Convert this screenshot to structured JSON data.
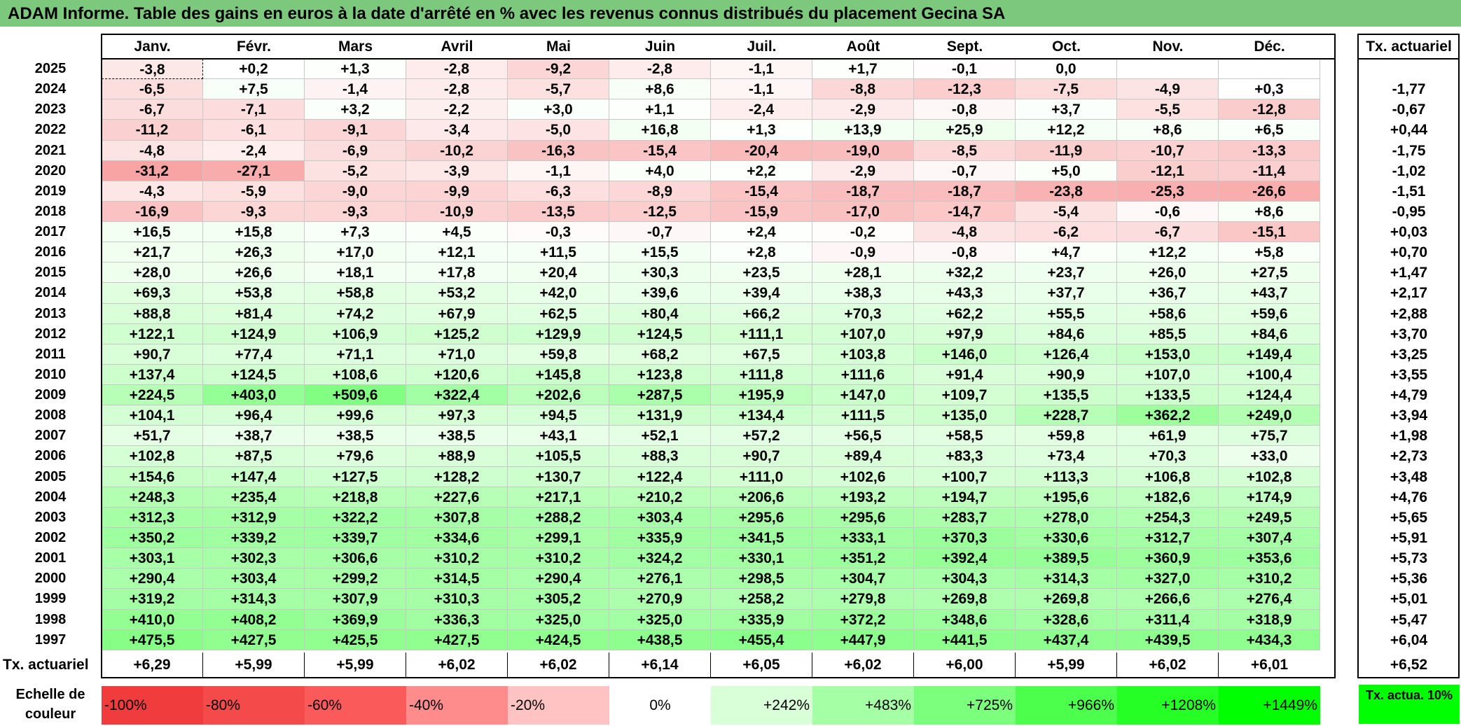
{
  "title": "ADAM Informe. Table des gains en euros à la date d'arrêté en % avec les revenus connus distribués du placement Gecina SA",
  "months": [
    "Janv.",
    "Févr.",
    "Mars",
    "Avril",
    "Mai",
    "Juin",
    "Juil.",
    "Août",
    "Sept.",
    "Oct.",
    "Nov.",
    "Déc."
  ],
  "annual_header": "Tx. actuariel",
  "rows": [
    {
      "year": "2025",
      "values": [
        "-3,8",
        "+0,2",
        "+1,3",
        "-2,8",
        "-9,2",
        "-2,8",
        "-1,1",
        "+1,7",
        "-0,1",
        "0,0",
        "",
        ""
      ],
      "annual": ""
    },
    {
      "year": "2024",
      "values": [
        "-6,5",
        "+7,5",
        "-1,4",
        "-2,8",
        "-5,7",
        "+8,6",
        "-1,1",
        "-8,8",
        "-12,3",
        "-7,5",
        "-4,9",
        "+0,3"
      ],
      "annual": "-1,77"
    },
    {
      "year": "2023",
      "values": [
        "-6,7",
        "-7,1",
        "+3,2",
        "-2,2",
        "+3,0",
        "+1,1",
        "-2,4",
        "-2,9",
        "-0,8",
        "+3,7",
        "-5,5",
        "-12,8"
      ],
      "annual": "-0,67"
    },
    {
      "year": "2022",
      "values": [
        "-11,2",
        "-6,1",
        "-9,1",
        "-3,4",
        "-5,0",
        "+16,8",
        "+1,3",
        "+13,9",
        "+25,9",
        "+12,2",
        "+8,6",
        "+6,5"
      ],
      "annual": "+0,44"
    },
    {
      "year": "2021",
      "values": [
        "-4,8",
        "-2,4",
        "-6,9",
        "-10,2",
        "-16,3",
        "-15,4",
        "-20,4",
        "-19,0",
        "-8,5",
        "-11,9",
        "-10,7",
        "-13,3"
      ],
      "annual": "-1,75"
    },
    {
      "year": "2020",
      "values": [
        "-31,2",
        "-27,1",
        "-5,2",
        "-3,9",
        "-1,1",
        "+4,0",
        "+2,2",
        "-2,9",
        "-0,7",
        "+5,0",
        "-12,1",
        "-11,4"
      ],
      "annual": "-1,02"
    },
    {
      "year": "2019",
      "values": [
        "-4,3",
        "-5,9",
        "-9,0",
        "-9,9",
        "-6,3",
        "-8,9",
        "-15,4",
        "-18,7",
        "-18,7",
        "-23,8",
        "-25,3",
        "-26,6"
      ],
      "annual": "-1,51"
    },
    {
      "year": "2018",
      "values": [
        "-16,9",
        "-9,3",
        "-9,3",
        "-10,9",
        "-13,5",
        "-12,5",
        "-15,9",
        "-17,0",
        "-14,7",
        "-5,4",
        "-0,6",
        "+8,6"
      ],
      "annual": "-0,95"
    },
    {
      "year": "2017",
      "values": [
        "+16,5",
        "+15,8",
        "+7,3",
        "+4,5",
        "-0,3",
        "-0,7",
        "+2,4",
        "-0,2",
        "-4,8",
        "-6,2",
        "-6,7",
        "-15,1"
      ],
      "annual": "+0,03"
    },
    {
      "year": "2016",
      "values": [
        "+21,7",
        "+26,3",
        "+17,0",
        "+12,1",
        "+11,5",
        "+15,5",
        "+2,8",
        "-0,9",
        "-0,8",
        "+4,7",
        "+12,2",
        "+5,8"
      ],
      "annual": "+0,70"
    },
    {
      "year": "2015",
      "values": [
        "+28,0",
        "+26,6",
        "+18,1",
        "+17,8",
        "+20,4",
        "+30,3",
        "+23,5",
        "+28,1",
        "+32,2",
        "+23,7",
        "+26,0",
        "+27,5"
      ],
      "annual": "+1,47"
    },
    {
      "year": "2014",
      "values": [
        "+69,3",
        "+53,8",
        "+58,8",
        "+53,2",
        "+42,0",
        "+39,6",
        "+39,4",
        "+38,3",
        "+43,3",
        "+37,7",
        "+36,7",
        "+43,7"
      ],
      "annual": "+2,17"
    },
    {
      "year": "2013",
      "values": [
        "+88,8",
        "+81,4",
        "+74,2",
        "+67,9",
        "+62,5",
        "+80,4",
        "+66,2",
        "+70,3",
        "+62,2",
        "+55,5",
        "+58,6",
        "+59,6"
      ],
      "annual": "+2,88"
    },
    {
      "year": "2012",
      "values": [
        "+122,1",
        "+124,9",
        "+106,9",
        "+125,2",
        "+129,9",
        "+124,5",
        "+111,1",
        "+107,0",
        "+97,9",
        "+84,6",
        "+85,5",
        "+84,6"
      ],
      "annual": "+3,70"
    },
    {
      "year": "2011",
      "values": [
        "+90,7",
        "+77,4",
        "+71,1",
        "+71,0",
        "+59,8",
        "+68,2",
        "+67,5",
        "+103,8",
        "+146,0",
        "+126,4",
        "+153,0",
        "+149,4"
      ],
      "annual": "+3,25"
    },
    {
      "year": "2010",
      "values": [
        "+137,4",
        "+124,5",
        "+108,6",
        "+120,6",
        "+145,8",
        "+123,8",
        "+111,8",
        "+111,6",
        "+91,4",
        "+90,9",
        "+107,0",
        "+100,4"
      ],
      "annual": "+3,55"
    },
    {
      "year": "2009",
      "values": [
        "+224,5",
        "+403,0",
        "+509,6",
        "+322,4",
        "+202,6",
        "+287,5",
        "+195,9",
        "+147,0",
        "+109,7",
        "+135,5",
        "+133,5",
        "+124,4"
      ],
      "annual": "+4,79"
    },
    {
      "year": "2008",
      "values": [
        "+104,1",
        "+96,4",
        "+99,6",
        "+97,3",
        "+94,5",
        "+131,9",
        "+134,4",
        "+111,5",
        "+135,0",
        "+228,7",
        "+362,2",
        "+249,0"
      ],
      "annual": "+3,94"
    },
    {
      "year": "2007",
      "values": [
        "+51,7",
        "+38,7",
        "+38,5",
        "+38,5",
        "+43,1",
        "+52,1",
        "+57,2",
        "+56,5",
        "+58,5",
        "+59,8",
        "+61,9",
        "+75,7"
      ],
      "annual": "+1,98"
    },
    {
      "year": "2006",
      "values": [
        "+102,8",
        "+87,5",
        "+79,6",
        "+88,9",
        "+105,5",
        "+88,3",
        "+90,7",
        "+89,4",
        "+83,3",
        "+73,4",
        "+70,3",
        "+33,0"
      ],
      "annual": "+2,73"
    },
    {
      "year": "2005",
      "values": [
        "+154,6",
        "+147,4",
        "+127,5",
        "+128,2",
        "+130,7",
        "+122,4",
        "+111,0",
        "+102,6",
        "+100,7",
        "+113,3",
        "+106,8",
        "+102,8"
      ],
      "annual": "+3,48"
    },
    {
      "year": "2004",
      "values": [
        "+248,3",
        "+235,4",
        "+218,8",
        "+227,6",
        "+217,1",
        "+210,2",
        "+206,6",
        "+193,2",
        "+194,7",
        "+195,6",
        "+182,6",
        "+174,9"
      ],
      "annual": "+4,76"
    },
    {
      "year": "2003",
      "values": [
        "+312,3",
        "+312,9",
        "+322,2",
        "+307,8",
        "+288,2",
        "+303,4",
        "+295,6",
        "+295,6",
        "+283,7",
        "+278,0",
        "+254,3",
        "+249,5"
      ],
      "annual": "+5,65"
    },
    {
      "year": "2002",
      "values": [
        "+350,2",
        "+339,2",
        "+339,7",
        "+334,6",
        "+299,1",
        "+335,9",
        "+341,5",
        "+333,1",
        "+370,3",
        "+330,6",
        "+312,7",
        "+307,4"
      ],
      "annual": "+5,91"
    },
    {
      "year": "2001",
      "values": [
        "+303,1",
        "+302,3",
        "+306,6",
        "+310,2",
        "+310,2",
        "+324,2",
        "+330,1",
        "+351,2",
        "+392,4",
        "+389,5",
        "+360,9",
        "+353,6"
      ],
      "annual": "+5,73"
    },
    {
      "year": "2000",
      "values": [
        "+290,4",
        "+303,4",
        "+299,2",
        "+314,5",
        "+290,4",
        "+276,1",
        "+298,5",
        "+304,7",
        "+304,3",
        "+314,3",
        "+327,0",
        "+310,2"
      ],
      "annual": "+5,36"
    },
    {
      "year": "1999",
      "values": [
        "+319,2",
        "+314,3",
        "+307,9",
        "+310,3",
        "+305,2",
        "+270,9",
        "+258,2",
        "+279,8",
        "+269,8",
        "+269,8",
        "+266,6",
        "+276,4"
      ],
      "annual": "+5,01"
    },
    {
      "year": "1998",
      "values": [
        "+410,0",
        "+408,2",
        "+369,9",
        "+336,3",
        "+325,0",
        "+325,0",
        "+335,9",
        "+372,2",
        "+348,6",
        "+328,6",
        "+311,4",
        "+318,9"
      ],
      "annual": "+5,47"
    },
    {
      "year": "1997",
      "values": [
        "+475,5",
        "+427,5",
        "+425,5",
        "+427,5",
        "+424,5",
        "+438,5",
        "+455,4",
        "+447,9",
        "+441,5",
        "+437,4",
        "+439,5",
        "+434,3"
      ],
      "annual": "+6,04"
    }
  ],
  "totals_label": "Tx. actuariel",
  "totals": [
    "+6,29",
    "+5,99",
    "+5,99",
    "+6,02",
    "+6,02",
    "+6,14",
    "+6,05",
    "+6,02",
    "+6,00",
    "+5,99",
    "+6,02",
    "+6,01"
  ],
  "totals_annual": "+6,52",
  "legend_label": "Echelle de couleur",
  "legend": [
    {
      "label": "-100%",
      "color": "#f03c3c",
      "align": "left"
    },
    {
      "label": "-80%",
      "color": "#f44a4a",
      "align": "left"
    },
    {
      "label": "-60%",
      "color": "#fa5a5a",
      "align": "left"
    },
    {
      "label": "-40%",
      "color": "#ff8c8c",
      "align": "left"
    },
    {
      "label": "-20%",
      "color": "#ffc3c3",
      "align": "left"
    },
    {
      "label": "0%",
      "color": "#ffffff",
      "align": "center"
    },
    {
      "label": "+242%",
      "color": "#d9ffd9",
      "align": "right"
    },
    {
      "label": "+483%",
      "color": "#a5ffa5",
      "align": "right"
    },
    {
      "label": "+725%",
      "color": "#7cff7c",
      "align": "right"
    },
    {
      "label": "+966%",
      "color": "#4cff4c",
      "align": "right"
    },
    {
      "label": "+1208%",
      "color": "#26ff26",
      "align": "right"
    },
    {
      "label": "+1449%",
      "color": "#00ff00",
      "align": "right"
    }
  ],
  "legend_right_label": "Tx. actua. 10%",
  "colors": {
    "title_bg": "#7cc87c",
    "negative_max": "#f03c3c",
    "positive_max": "#00ff00"
  }
}
